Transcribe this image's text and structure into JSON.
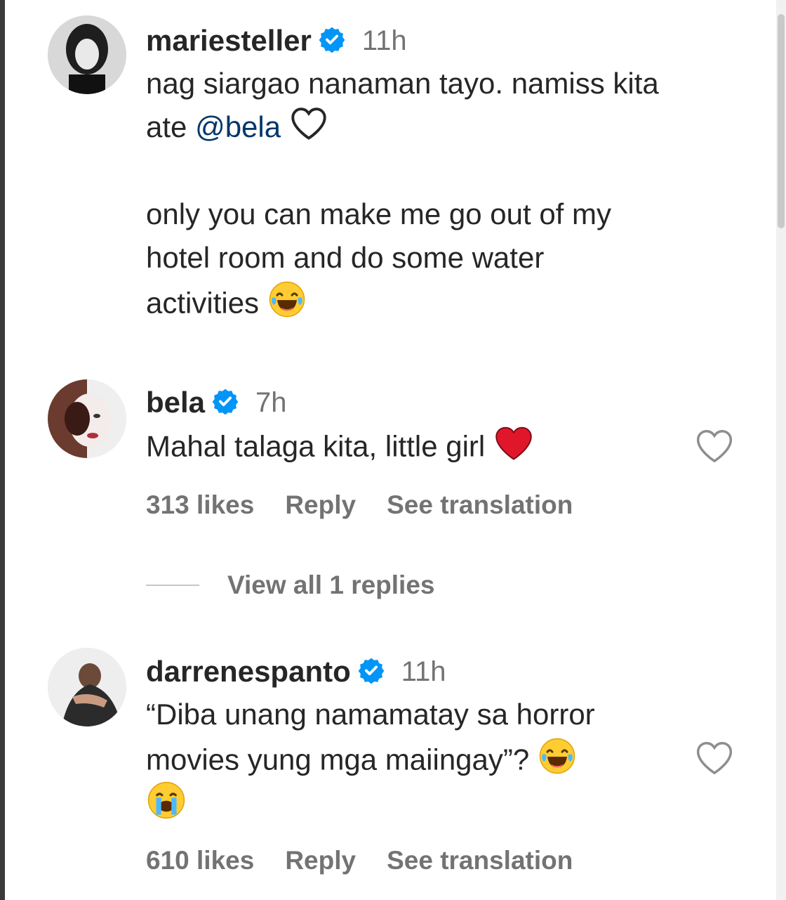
{
  "comments": [
    {
      "username": "mariesteller",
      "time": "11h",
      "lines": [
        "nag siargao nanaman tayo. namiss kita",
        "only you can make me go out of my",
        "hotel room and do some water",
        "activities"
      ],
      "line2_prefix": "ate",
      "mention": "@bela"
    },
    {
      "username": "bela",
      "time": "7h",
      "text": "Mahal talaga kita, little girl",
      "likes": "313 likes",
      "reply": "Reply",
      "translate": "See translation",
      "view_replies": "View all 1 replies"
    },
    {
      "username": "darrenespanto",
      "time": "11h",
      "lines": [
        "“Diba unang namamatay sa horror",
        "movies yung mga maiingay”?"
      ],
      "likes": "610 likes",
      "reply": "Reply",
      "translate": "See translation"
    }
  ],
  "colors": {
    "verified": "#0095f6",
    "mention": "#00376b",
    "heart_red": "#e0162b",
    "muted": "#737373"
  },
  "icons": [
    "verified-badge-icon",
    "heart-outline-icon",
    "red-heart-icon",
    "laughing-tears-emoji",
    "crying-emoji"
  ]
}
